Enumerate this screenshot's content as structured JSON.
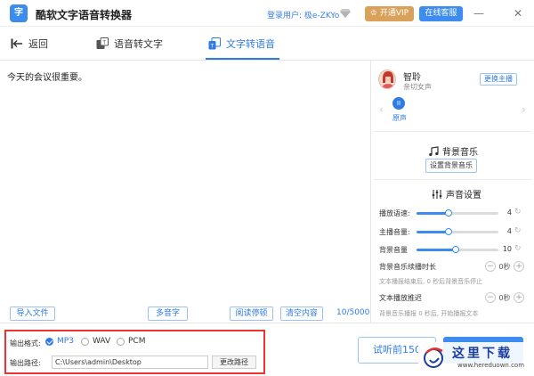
{
  "app": {
    "title": "酷软文字语音转换器",
    "logo_text": "字",
    "login_label": "登录用户: 极e-ZKYo",
    "vip_label": "开通VIP",
    "service_label": "在线客服",
    "minimize": "—",
    "close": "✕"
  },
  "tabs": {
    "back": "返回",
    "speech_to_text": "语音转文字",
    "text_to_speech": "文字转语音",
    "active": "text_to_speech"
  },
  "editor": {
    "text": "今天的会议很重要。",
    "import_label": "导入文件",
    "polyphone_label": "多音字",
    "pause_label": "阅读停顿",
    "clear_label": "清空内容",
    "counter": "10/5000"
  },
  "voice": {
    "name": "智聆",
    "desc": "亲切女声",
    "change_label": "更换主播",
    "original_label": "原声",
    "pause_glyph": "II"
  },
  "bgm": {
    "title": "背景音乐",
    "set_label": "设置背景音乐"
  },
  "sound": {
    "title": "声音设置",
    "sliders": [
      {
        "label": "播放语速:",
        "value": 4,
        "fraction": 0.39
      },
      {
        "label": "主播音量:",
        "value": 4,
        "fraction": 0.39
      },
      {
        "label": "背景音量",
        "value": 10,
        "fraction": 0.48
      }
    ],
    "bgm_delay": {
      "label": "背景音乐续播时长",
      "value": "0秒",
      "hint": "文本播报结束后,  0 秒后背景音乐停止"
    },
    "text_delay": {
      "label": "文本播放推迟",
      "value": "0秒",
      "hint": "背景音乐播报 0 秒后, 开始播报文本"
    }
  },
  "output": {
    "format_label": "输出格式:",
    "formats": [
      "MP3",
      "WAV",
      "PCM"
    ],
    "selected_format": "MP3",
    "path_label": "输出路径:",
    "path_value": "C:\\Users\\admin\\Desktop",
    "change_path_label": "更改路径"
  },
  "actions": {
    "trial_label": "试听前150"
  },
  "watermark": {
    "title": "这里下载",
    "url": "www.hereduown.com"
  },
  "colors": {
    "accent": "#2f7be6",
    "vip": "#d9a15a",
    "highlight_box": "#e33333"
  }
}
